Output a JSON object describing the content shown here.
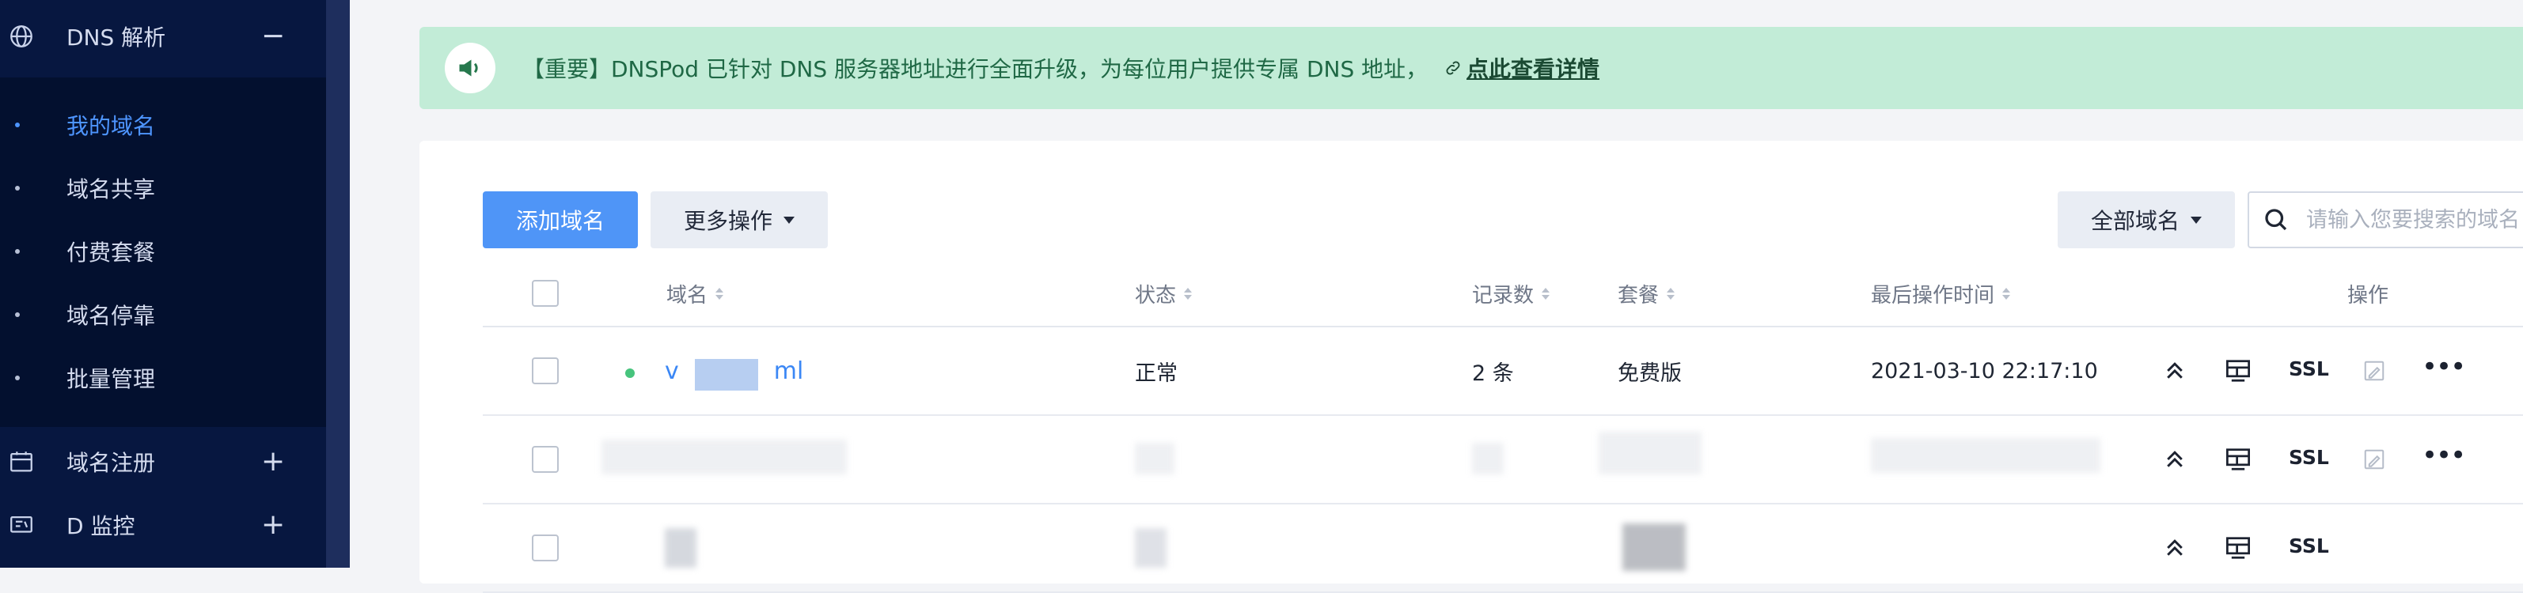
{
  "sidebar": {
    "section_title": "DNS 解析",
    "section_toggle": "−",
    "items": [
      {
        "label": "我的域名",
        "active": true
      },
      {
        "label": "域名共享",
        "active": false
      },
      {
        "label": "付费套餐",
        "active": false
      },
      {
        "label": "域名停靠",
        "active": false
      },
      {
        "label": "批量管理",
        "active": false
      }
    ],
    "groups": [
      {
        "label": "域名注册",
        "toggle": "+"
      },
      {
        "label": "D 监控",
        "toggle": "+"
      }
    ]
  },
  "notice": {
    "text": "【重要】DNSPod 已针对 DNS 服务器地址进行全面升级，为每位用户提供专属 DNS 地址，",
    "link_label": "点此查看详情"
  },
  "toolbar": {
    "add_label": "添加域名",
    "more_label": "更多操作",
    "filter_label": "全部域名",
    "search_placeholder": "请输入您要搜索的域名"
  },
  "table": {
    "headers": {
      "domain": "域名",
      "status": "状态",
      "records": "记录数",
      "plan": "套餐",
      "updated": "最后操作时间",
      "actions": "操作"
    },
    "rows": [
      {
        "domain_prefix": "v",
        "domain_suffix": "ml",
        "status": "正常",
        "records": "2 条",
        "plan": "免费版",
        "updated": "2021-03-10 22:17:10",
        "ssl": "SSL"
      },
      {
        "ssl": "SSL"
      },
      {
        "ssl": "SSL"
      }
    ]
  },
  "colors": {
    "sidebar_bg": "#071740",
    "accent": "#4f95f7",
    "notice_bg": "#c2ecd7",
    "status_ok": "#47c47d"
  }
}
